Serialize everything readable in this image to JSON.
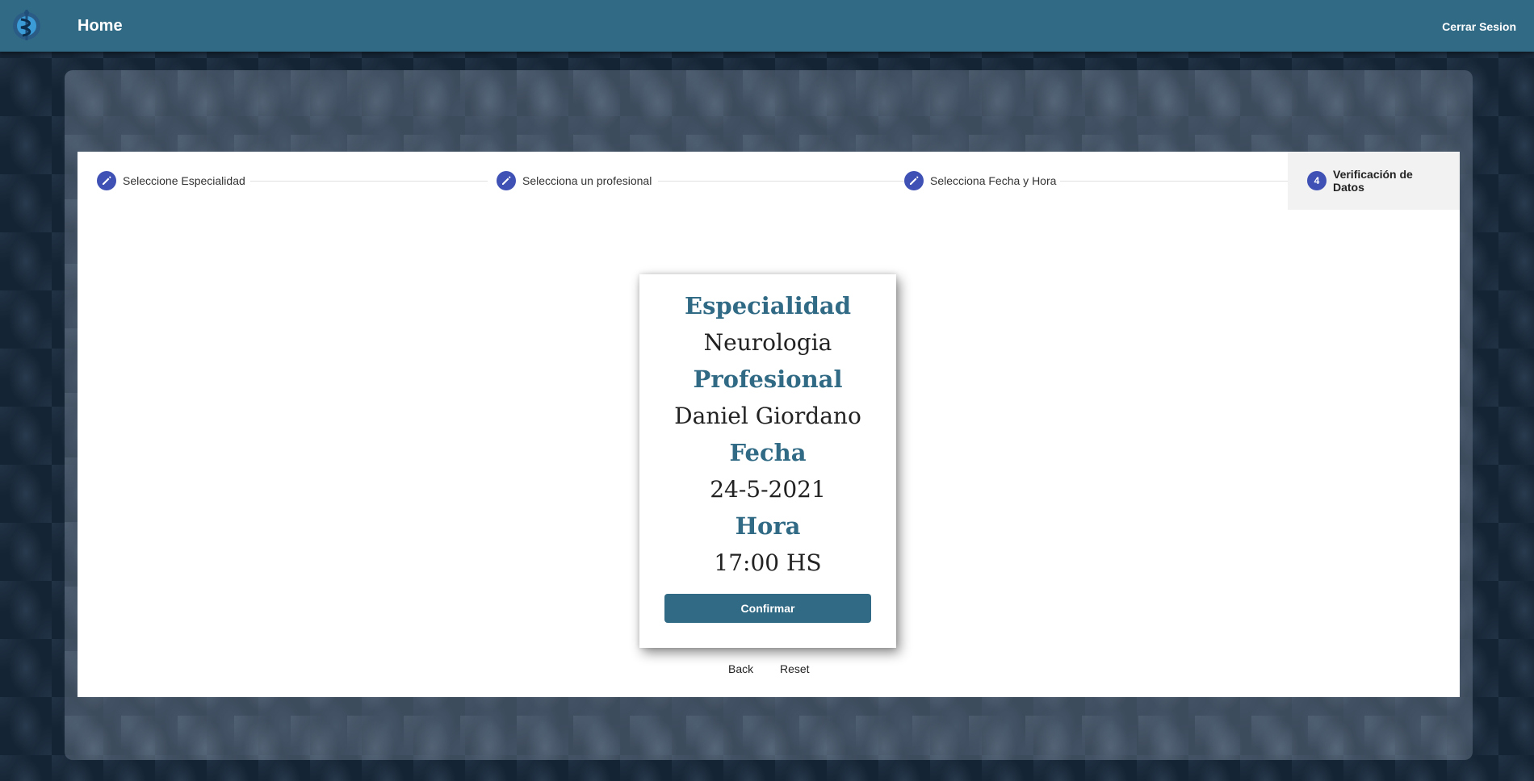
{
  "topbar": {
    "title": "Home",
    "logout_label": "Cerrar Sesion",
    "logo_icon": "medical-caduceus-icon",
    "background_color": "#316a85"
  },
  "stepper": {
    "steps": [
      {
        "label": "Seleccione Especialidad",
        "icon": "edit-pencil-icon",
        "state": "completed"
      },
      {
        "label": "Selecciona un profesional",
        "icon": "edit-pencil-icon",
        "state": "completed"
      },
      {
        "label": "Selecciona Fecha y Hora",
        "icon": "edit-pencil-icon",
        "state": "completed"
      },
      {
        "label": "Verificación de Datos",
        "number": "4",
        "state": "active"
      }
    ],
    "accent_color": "#3f51b5"
  },
  "summary": {
    "specialty_label": "Especialidad",
    "specialty_value": "Neurologia",
    "professional_label": "Profesional",
    "professional_value": "Daniel Giordano",
    "date_label": "Fecha",
    "date_value": "24-5-2021",
    "time_label": "Hora",
    "time_value": "17:00 HS",
    "confirm_label": "Confirmar"
  },
  "navigation": {
    "back_label": "Back",
    "reset_label": "Reset"
  }
}
